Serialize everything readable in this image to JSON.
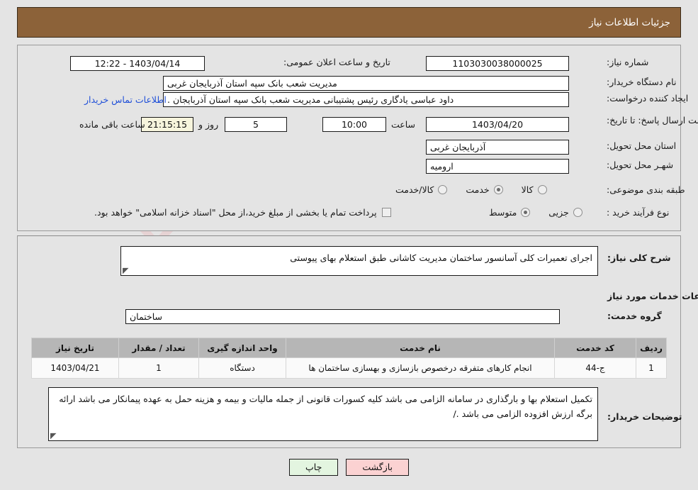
{
  "header": {
    "title": "جزئیات اطلاعات نیاز"
  },
  "form": {
    "need_number_label": "شماره نیاز:",
    "need_number_value": "1103030038000025",
    "public_announce_label": "تاریخ و ساعت اعلان عمومی:",
    "public_announce_value": "1403/04/14 - 12:22",
    "buyer_org_label": "نام دستگاه خریدار:",
    "buyer_org_value": "مدیریت شعب بانک سپه استان آذربایجان غربی",
    "requester_label": "ایجاد کننده درخواست:",
    "requester_value": "داود عباسی یادگاری رئیس پشتیبانی مدیریت شعب بانک سپه استان آذربایجان .",
    "contact_link": "اطلاعات تماس خریدار",
    "deadline_label": "مهلت ارسال پاسخ: تا تاریخ:",
    "deadline_date": "1403/04/20",
    "time_label": "ساعت",
    "deadline_time": "10:00",
    "days_value": "5",
    "days_and_label": "روز و",
    "countdown_value": "21:15:15",
    "remaining_label": "ساعت باقی مانده",
    "province_label": "استان محل تحویل:",
    "province_value": "آذربایجان غربی",
    "city_label": "شهـر محل تحویل:",
    "city_value": "ارومیه",
    "category_label": "طبقه بندی موضوعی:",
    "category_options": [
      {
        "label": "کالا",
        "selected": false
      },
      {
        "label": "خدمت",
        "selected": true
      },
      {
        "label": "کالا/خدمت",
        "selected": false
      }
    ],
    "process_label": "نوع فرآیند خرید :",
    "process_options": [
      {
        "label": "جزیی",
        "selected": false
      },
      {
        "label": "متوسط",
        "selected": true
      }
    ],
    "treasury_checkbox_label": "پرداخت تمام یا بخشی از مبلغ خرید،از محل \"اسناد خزانه اسلامی\" خواهد بود.",
    "treasury_checked": false
  },
  "description": {
    "label": "شرح کلی نیاز:",
    "value": "اجرای  تعمیرات کلی  آسانسور ساختمان مدیریت کاشانی طبق استعلام بهای پیوستی"
  },
  "services_section": {
    "heading": "اطلاعات خدمات مورد نیاز",
    "group_label": "گروه خدمت:",
    "group_value": "ساختمان"
  },
  "table": {
    "columns": [
      "ردیف",
      "کد خدمت",
      "نام خدمت",
      "واحد اندازه گیری",
      "تعداد / مقدار",
      "تاریخ نیاز"
    ],
    "rows": [
      [
        "1",
        "ج-44",
        "انجام کارهای متفرقه درخصوص بازسازی و بهسازی ساختمان ها",
        "دستگاه",
        "1",
        "1403/04/21"
      ]
    ]
  },
  "buyer_notes": {
    "label": "توضیحات خریدار:",
    "value": "تکمیل استعلام بها و بارگذاری در سامانه الزامی می باشد کلیه کسورات قانونی از جمله مالیات و بیمه و هزینه حمل  به عهده پیمانکار می باشد ارائه برگه ارزش افزوده الزامی می باشد ./"
  },
  "footer": {
    "back_label": "بازگشت",
    "print_label": "چاپ"
  },
  "watermark": {
    "text": "AriaTender.net"
  },
  "colors": {
    "header_bar": "#8c6239",
    "page_bg": "#e4e4e4",
    "link": "#1f4fd8",
    "countdown_bg": "#f7f5dd",
    "back_button": "#fbd2d2",
    "print_button": "#e3f5e0",
    "table_header": "#b6b6b6"
  }
}
